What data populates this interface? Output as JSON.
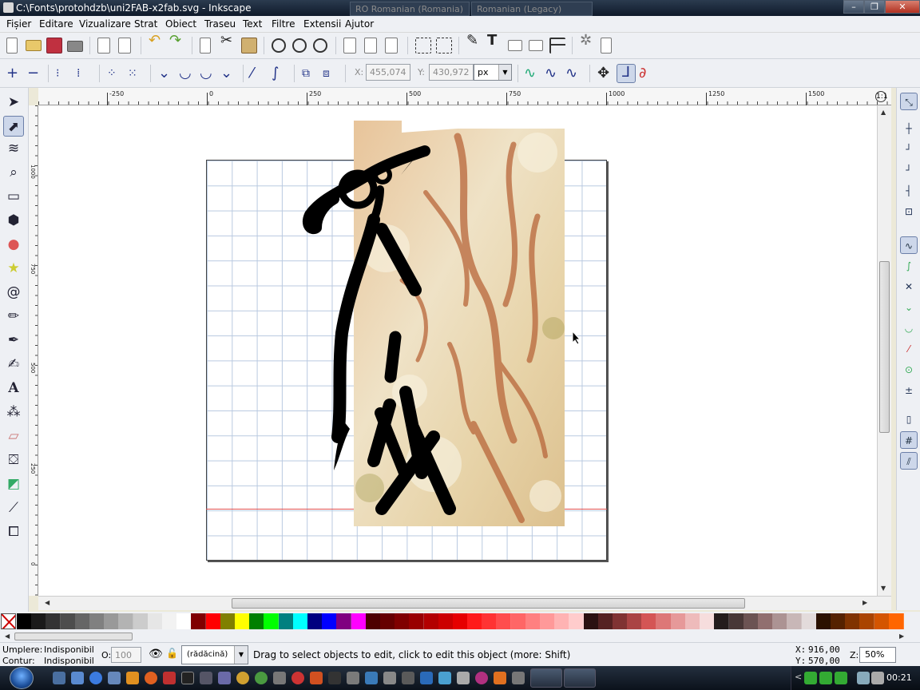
{
  "window": {
    "title": "C:\\Fonts\\protohdzb\\uni2FAB-x2fab.svg - Inkscape",
    "lang1": "RO Romanian (Romania)",
    "lang2": "Romanian (Legacy)",
    "minimize": "–",
    "maximize": "❐",
    "close": "✕"
  },
  "menu": [
    "Fișier",
    "Editare",
    "Vizualizare",
    "Strat",
    "Obiect",
    "Traseu",
    "Text",
    "Filtre",
    "Extensii",
    "Ajutor"
  ],
  "node_toolbar": {
    "x_label": "X:",
    "x_value": "455,074",
    "y_label": "Y:",
    "y_value": "430,972",
    "unit": "px"
  },
  "ruler": {
    "h_labels": [
      "-250",
      "0",
      "250",
      "500",
      "750",
      "1000",
      "1250",
      "1500"
    ],
    "v_labels": [
      "1000",
      "750",
      "500",
      "250",
      "0"
    ]
  },
  "palette": {
    "colors": [
      "#000000",
      "#1a1a1a",
      "#333333",
      "#4d4d4d",
      "#666666",
      "#808080",
      "#999999",
      "#b3b3b3",
      "#cccccc",
      "#e6e6e6",
      "#f2f2f2",
      "#ffffff",
      "#800000",
      "#ff0000",
      "#808000",
      "#ffff00",
      "#008000",
      "#00ff00",
      "#008080",
      "#00ffff",
      "#000080",
      "#0000ff",
      "#800080",
      "#ff00ff",
      "#4d0000",
      "#660000",
      "#800000",
      "#990000",
      "#b30000",
      "#cc0000",
      "#e60000",
      "#ff1a1a",
      "#ff3333",
      "#ff4d4d",
      "#ff6666",
      "#ff8080",
      "#ff9999",
      "#ffb3b3",
      "#ffcccc",
      "#2b1111",
      "#552222",
      "#803333",
      "#aa4444",
      "#d45555",
      "#dd7777",
      "#e69999",
      "#eebbbb",
      "#f6dddd",
      "#241c1c",
      "#483737",
      "#6c5353",
      "#916f6f",
      "#ac9393",
      "#c8b7b7",
      "#e3dbdb",
      "#2b1100",
      "#552200",
      "#803300",
      "#aa4400",
      "#d45500",
      "#ff6600"
    ]
  },
  "status": {
    "fill_label": "Umplere:",
    "fill_value": "Indisponibil",
    "stroke_label": "Contur:",
    "stroke_value": "Indisponibil",
    "opacity_label": "O:",
    "opacity_value": "100",
    "layer": "(rădăcină)",
    "message": "Drag to select objects to edit, click to edit this object (more: Shift)",
    "x_label": "X:",
    "x_value": "916,00",
    "y_label": "Y:",
    "y_value": "570,00",
    "zoom_label": "Z:",
    "zoom_value": "50%"
  },
  "taskbar": {
    "clock": "00:21"
  }
}
